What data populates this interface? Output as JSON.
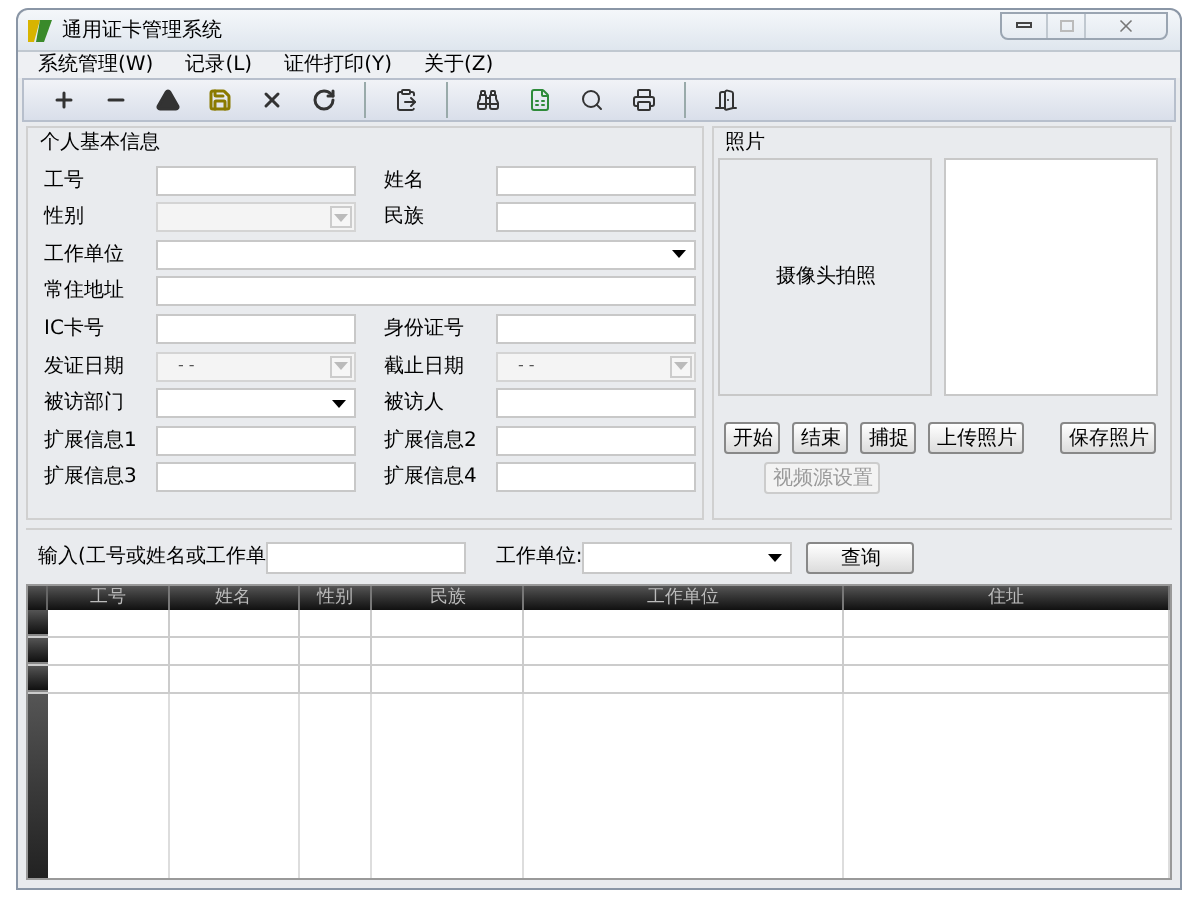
{
  "window": {
    "title": "通用证卡管理系统"
  },
  "menu": [
    "系统管理(W)",
    "记录(L)",
    "证件打印(Y)",
    "关于(Z)"
  ],
  "info_group": {
    "title": "个人基本信息",
    "rows": [
      {
        "fields": [
          {
            "label": "工号",
            "kind": "text"
          },
          {
            "label": "姓名",
            "kind": "text"
          }
        ]
      },
      {
        "fields": [
          {
            "label": "性别",
            "kind": "disabled-combo"
          },
          {
            "label": "民族",
            "kind": "text"
          }
        ]
      },
      {
        "fields": [
          {
            "label": "工作单位",
            "kind": "combo"
          }
        ]
      },
      {
        "fields": [
          {
            "label": "常住地址",
            "kind": "text"
          }
        ]
      },
      {
        "fields": [
          {
            "label": "IC卡号",
            "kind": "text"
          },
          {
            "label": "身份证号",
            "kind": "text"
          }
        ]
      },
      {
        "fields": [
          {
            "label": "发证日期",
            "kind": "disabled-combo",
            "value": "- -"
          },
          {
            "label": "截止日期",
            "kind": "disabled-combo",
            "value": "- -"
          }
        ]
      },
      {
        "fields": [
          {
            "label": "被访部门",
            "kind": "combo"
          },
          {
            "label": "被访人",
            "kind": "text"
          }
        ]
      },
      {
        "fields": [
          {
            "label": "扩展信息1",
            "kind": "text"
          },
          {
            "label": "扩展信息2",
            "kind": "text"
          }
        ]
      },
      {
        "fields": [
          {
            "label": "扩展信息3",
            "kind": "text"
          },
          {
            "label": "扩展信息4",
            "kind": "text"
          }
        ]
      }
    ]
  },
  "photo_group": {
    "title": "照片",
    "camera_label": "摄像头拍照",
    "buttons": [
      {
        "label": "开始",
        "disabled": false
      },
      {
        "label": "结束",
        "disabled": false
      },
      {
        "label": "捕捉",
        "disabled": false
      },
      {
        "label": "上传照片",
        "disabled": false
      },
      {
        "label": "保存照片",
        "disabled": false
      },
      {
        "label": "视频源设置",
        "disabled": true
      }
    ]
  },
  "search": {
    "input_label": "输入(工号或姓名或工作单",
    "unit_label": "工作单位:",
    "button": "查询"
  },
  "table": {
    "columns": [
      "工号",
      "姓名",
      "性别",
      "民族",
      "工作单位",
      "住址"
    ]
  }
}
